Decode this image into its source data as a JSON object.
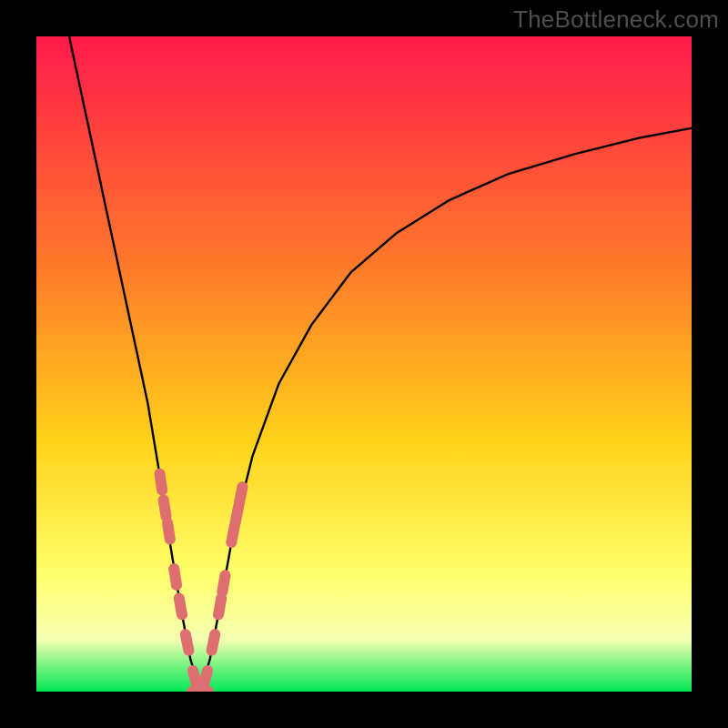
{
  "watermark": "TheBottleneck.com",
  "colors": {
    "gradient_top": "#ff1a4b",
    "gradient_mid1": "#ff7a2a",
    "gradient_mid2": "#ffd21a",
    "gradient_mid3": "#ffff6a",
    "gradient_band": "#f6ffb0",
    "gradient_bottom": "#00e756",
    "curve": "#000000",
    "marker": "#de6e6f",
    "frame": "#000000"
  },
  "chart_data": {
    "type": "line",
    "title": "",
    "xlabel": "",
    "ylabel": "",
    "xlim": [
      0,
      100
    ],
    "ylim": [
      0,
      100
    ],
    "grid": false,
    "legend": false,
    "notch_x": 25,
    "series": [
      {
        "name": "bottleneck-curve",
        "x": [
          5,
          8,
          11,
          14,
          17,
          19,
          20.5,
          22,
          23.5,
          25,
          26.5,
          28,
          30,
          33,
          37,
          42,
          48,
          55,
          63,
          72,
          82,
          92,
          100
        ],
        "y": [
          100,
          86,
          72,
          58,
          44,
          32,
          22,
          13,
          5,
          0,
          5,
          13,
          24,
          36,
          47,
          56,
          64,
          70,
          75,
          79,
          82,
          84.5,
          86
        ]
      }
    ],
    "markers": {
      "name": "highlight-dots",
      "x": [
        19.0,
        19.6,
        20.2,
        21.2,
        22.0,
        23.0,
        24.2,
        25.0,
        25.8,
        27.0,
        28.0,
        28.6,
        30.0,
        30.6,
        31.2
      ],
      "y": [
        32.0,
        28.0,
        24.5,
        17.5,
        13.0,
        7.5,
        2.0,
        0.0,
        2.0,
        7.5,
        13.0,
        16.5,
        24.0,
        27.0,
        30.0
      ]
    }
  }
}
